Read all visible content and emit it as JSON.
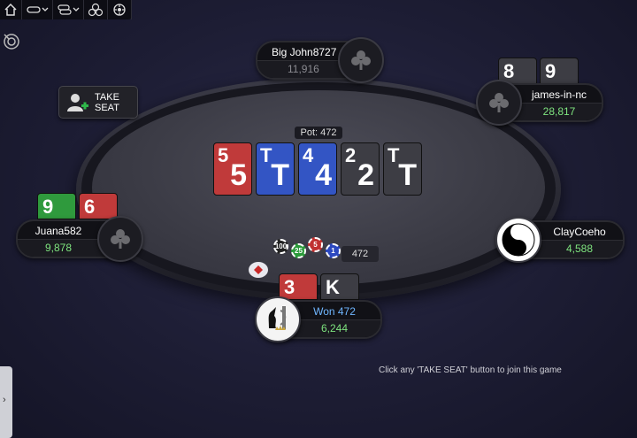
{
  "toolbar": {
    "icons": [
      "home-icon",
      "lobby-dropdown-icon",
      "tables-dropdown-icon",
      "cashier-icon",
      "settings-icon"
    ]
  },
  "table": {
    "pot_label": "Pot: 472",
    "felt_logo": "",
    "board": [
      {
        "rank": "5",
        "color": "#c03a3a"
      },
      {
        "rank": "T",
        "color": "#3355c4"
      },
      {
        "rank": "4",
        "color": "#3355c4"
      },
      {
        "rank": "2",
        "color": "#3d3d44"
      },
      {
        "rank": "T",
        "color": "#3d3d44"
      }
    ],
    "chips_amount": "472",
    "chip_labels": [
      "100",
      "25",
      "5",
      "1"
    ]
  },
  "seats": {
    "top": {
      "name": "Big John8727",
      "stack": "11,916"
    },
    "top_right": {
      "name": "james-in-nc",
      "stack": "28,817",
      "cards": [
        "8",
        "9"
      ]
    },
    "right": {
      "name": "ClayCoeho",
      "stack": "4,588"
    },
    "left": {
      "name": "Juana582",
      "stack": "9,878",
      "cards": [
        "9",
        "6"
      ]
    },
    "bottom": {
      "name": "Won 472",
      "stack": "6,244",
      "cards": [
        "3",
        "K"
      ]
    }
  },
  "take_seat": {
    "label_line1": "TAKE",
    "label_line2": "SEAT"
  },
  "hint_text": "Click any 'TAKE SEAT' button to join this game",
  "side_tab": {
    "label": "›"
  },
  "colors": {
    "stack_green": "#7ee37e",
    "winner_name": "#6fb6ff"
  }
}
